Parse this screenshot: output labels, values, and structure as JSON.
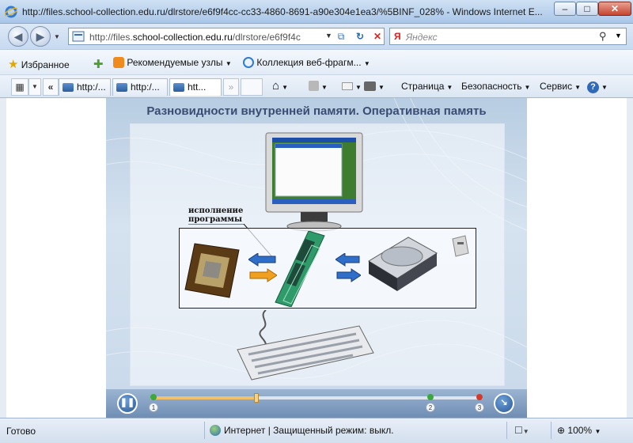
{
  "window": {
    "title": "http://files.school-collection.edu.ru/dlrstore/e6f9f4cc-cc33-4860-8691-a90e304e1ea3/%5BINF_028% - Windows Internet E...",
    "minimize": "–",
    "maximize": "□",
    "close": "✕"
  },
  "nav": {
    "back": "◀",
    "forward": "▶",
    "address_prefix": "http://files.",
    "address_domain": "school-collection.edu.ru",
    "address_suffix": "/dlrstore/e6f9f4c",
    "search_brand": "Я",
    "search_placeholder": "Яндекс"
  },
  "favorites_bar": {
    "favorites": "Избранное",
    "recommended": "Рекомендуемые узлы",
    "collection": "Коллекция веб-фрагм..."
  },
  "tabs": [
    {
      "label": "http:/..."
    },
    {
      "label": "http:/..."
    },
    {
      "label": "htt..."
    }
  ],
  "commands": {
    "page": "Страница",
    "safety": "Безопасность",
    "tools": "Сервис"
  },
  "slide": {
    "title": "Разновидности внутренней памяти. Оперативная память",
    "exec_label_line1": "исполнение",
    "exec_label_line2": "программы"
  },
  "player": {
    "progress": 0.32,
    "marks": [
      "1",
      "2",
      "3"
    ],
    "marker_colors": [
      "#3aa83a",
      "#3aa83a",
      "#d33a2a"
    ]
  },
  "status": {
    "ready": "Готово",
    "zone": "Интернет | Защищенный режим: выкл.",
    "zoom": "100%"
  }
}
